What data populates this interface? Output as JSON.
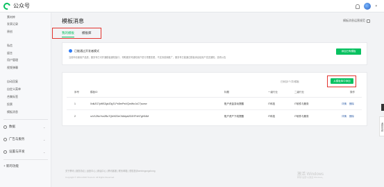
{
  "header": {
    "logo_text": "公众号"
  },
  "sidebar": {
    "items": [
      {
        "label": "素材库",
        "key": "material"
      },
      {
        "label": "发表记录",
        "key": "publish"
      },
      {
        "label": "原创",
        "key": "original"
      },
      {
        "label": "私信",
        "key": "messages"
      },
      {
        "label": "留言",
        "key": "comments"
      },
      {
        "label": "用户管理",
        "key": "users"
      },
      {
        "label": "视频弹幕",
        "key": "danmu"
      },
      {
        "label": "自动回复",
        "key": "autoreply"
      },
      {
        "label": "自定义菜单",
        "key": "menu"
      },
      {
        "label": "合集标签",
        "key": "tags"
      },
      {
        "label": "投票",
        "key": "vote"
      },
      {
        "label": "模板消息",
        "key": "template"
      }
    ],
    "groups": [
      {
        "label": "数据",
        "icon": "chart-icon"
      },
      {
        "label": "广告与服务",
        "icon": "ad-icon"
      },
      {
        "label": "设置与开发",
        "icon": "settings-icon"
      }
    ],
    "add_feature": "+ 新的功能"
  },
  "main": {
    "title": "模板消息",
    "help_link": "模板消息运营规范",
    "tabs": [
      {
        "label": "我的模板",
        "active": true
      },
      {
        "label": "模板库",
        "active": false
      }
    ],
    "notice": {
      "title": "已能通过开发者模式",
      "desc": "当前申请使用产品类，服务号已可开通模板通知接口，帮助服务号通知用户进行重要变更，不支持营销推广，服务号已能通过模板消息给用户发送通知。查看公告",
      "button": "添加已有模板"
    },
    "list": {
      "count_text": "已添加2个/共5模板",
      "add_button": "从模板库中添加",
      "columns": [
        "序号",
        "模板ID",
        "标题",
        "一级行业",
        "二级行业",
        "操作"
      ],
      "rows": [
        {
          "index": "1",
          "template_id": "0xlkZG7yWEZgbZ0g7LPx0lmPwVQmWnJoC7)vcew",
          "title": "账户资金变动提醒",
          "industry1": "IT科技",
          "industry2": "IT软件与服务",
          "actions": [
            "详情",
            "删除"
          ]
        },
        {
          "index": "2",
          "template_id": "xvV1ZNcYvnZBc7QbVfZ2eCMAlpA2D2t7FdH7gH34M",
          "title": "账户资产下线提醒",
          "industry1": "IT科技",
          "industry2": "IT软件与服务",
          "actions": [
            "详情",
            "删除"
          ]
        }
      ]
    }
  },
  "footer": {
    "links": "关于腾讯 | 服务协议 | 运营中心 | 辟谣中心 | 腾讯客服 | 联系邮箱 | 侵权投诉weixingongzhong",
    "copyright": "Copyright © 2012-2022 Tencent. All Rights Reserved."
  },
  "watermark": {
    "line1": "激活 Windows",
    "line2": "转到\"设置\"以激活 Windows。"
  },
  "edge": {
    "feedback_label": "遇到问题"
  },
  "colors": {
    "brand_green": "#07c160",
    "highlight_red": "#e3342f",
    "link_blue": "#2f5ea8"
  }
}
